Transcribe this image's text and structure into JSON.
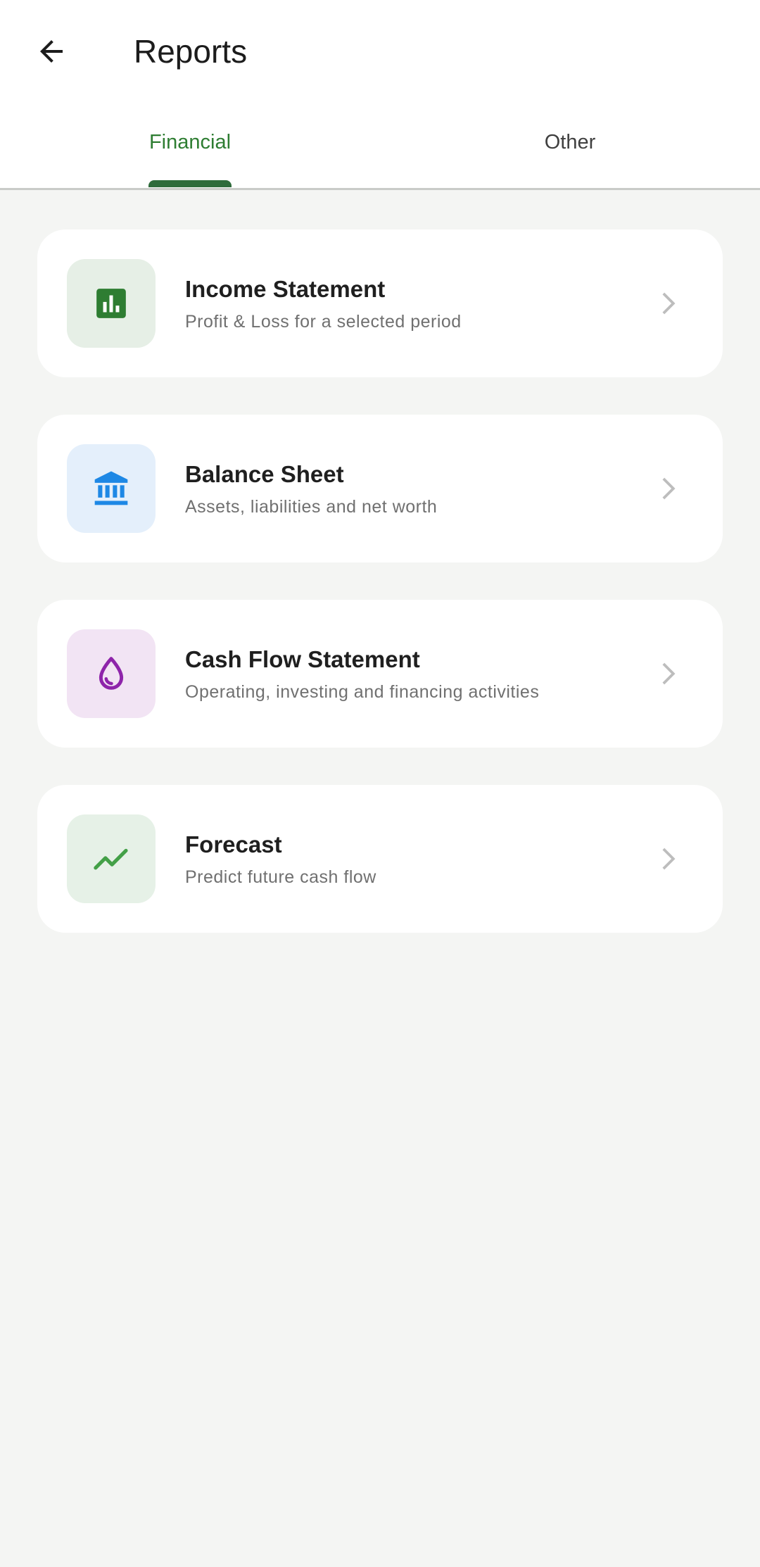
{
  "header": {
    "back_icon": "arrow-back-icon",
    "title": "Reports"
  },
  "tabs": [
    {
      "label": "Financial",
      "active": true
    },
    {
      "label": "Other",
      "active": false
    }
  ],
  "colors": {
    "accent": "#2e7d32",
    "tab_indicator": "#2e6b3b",
    "background": "#f4f5f3"
  },
  "reports": [
    {
      "title": "Income Statement",
      "subtitle": "Profit & Loss for a selected period",
      "icon": "bar-chart-icon",
      "icon_color": "#2e7d32",
      "icon_bg": "#e6efe6"
    },
    {
      "title": "Balance Sheet",
      "subtitle": "Assets, liabilities and net worth",
      "icon": "bank-icon",
      "icon_color": "#1e88e5",
      "icon_bg": "#e4effb"
    },
    {
      "title": "Cash Flow Statement",
      "subtitle": "Operating, investing and financing activities",
      "icon": "water-drop-icon",
      "icon_color": "#8e24aa",
      "icon_bg": "#f2e4f4"
    },
    {
      "title": "Forecast",
      "subtitle": "Predict future cash flow",
      "icon": "trending-up-icon",
      "icon_color": "#43a047",
      "icon_bg": "#e6f1e7"
    }
  ]
}
